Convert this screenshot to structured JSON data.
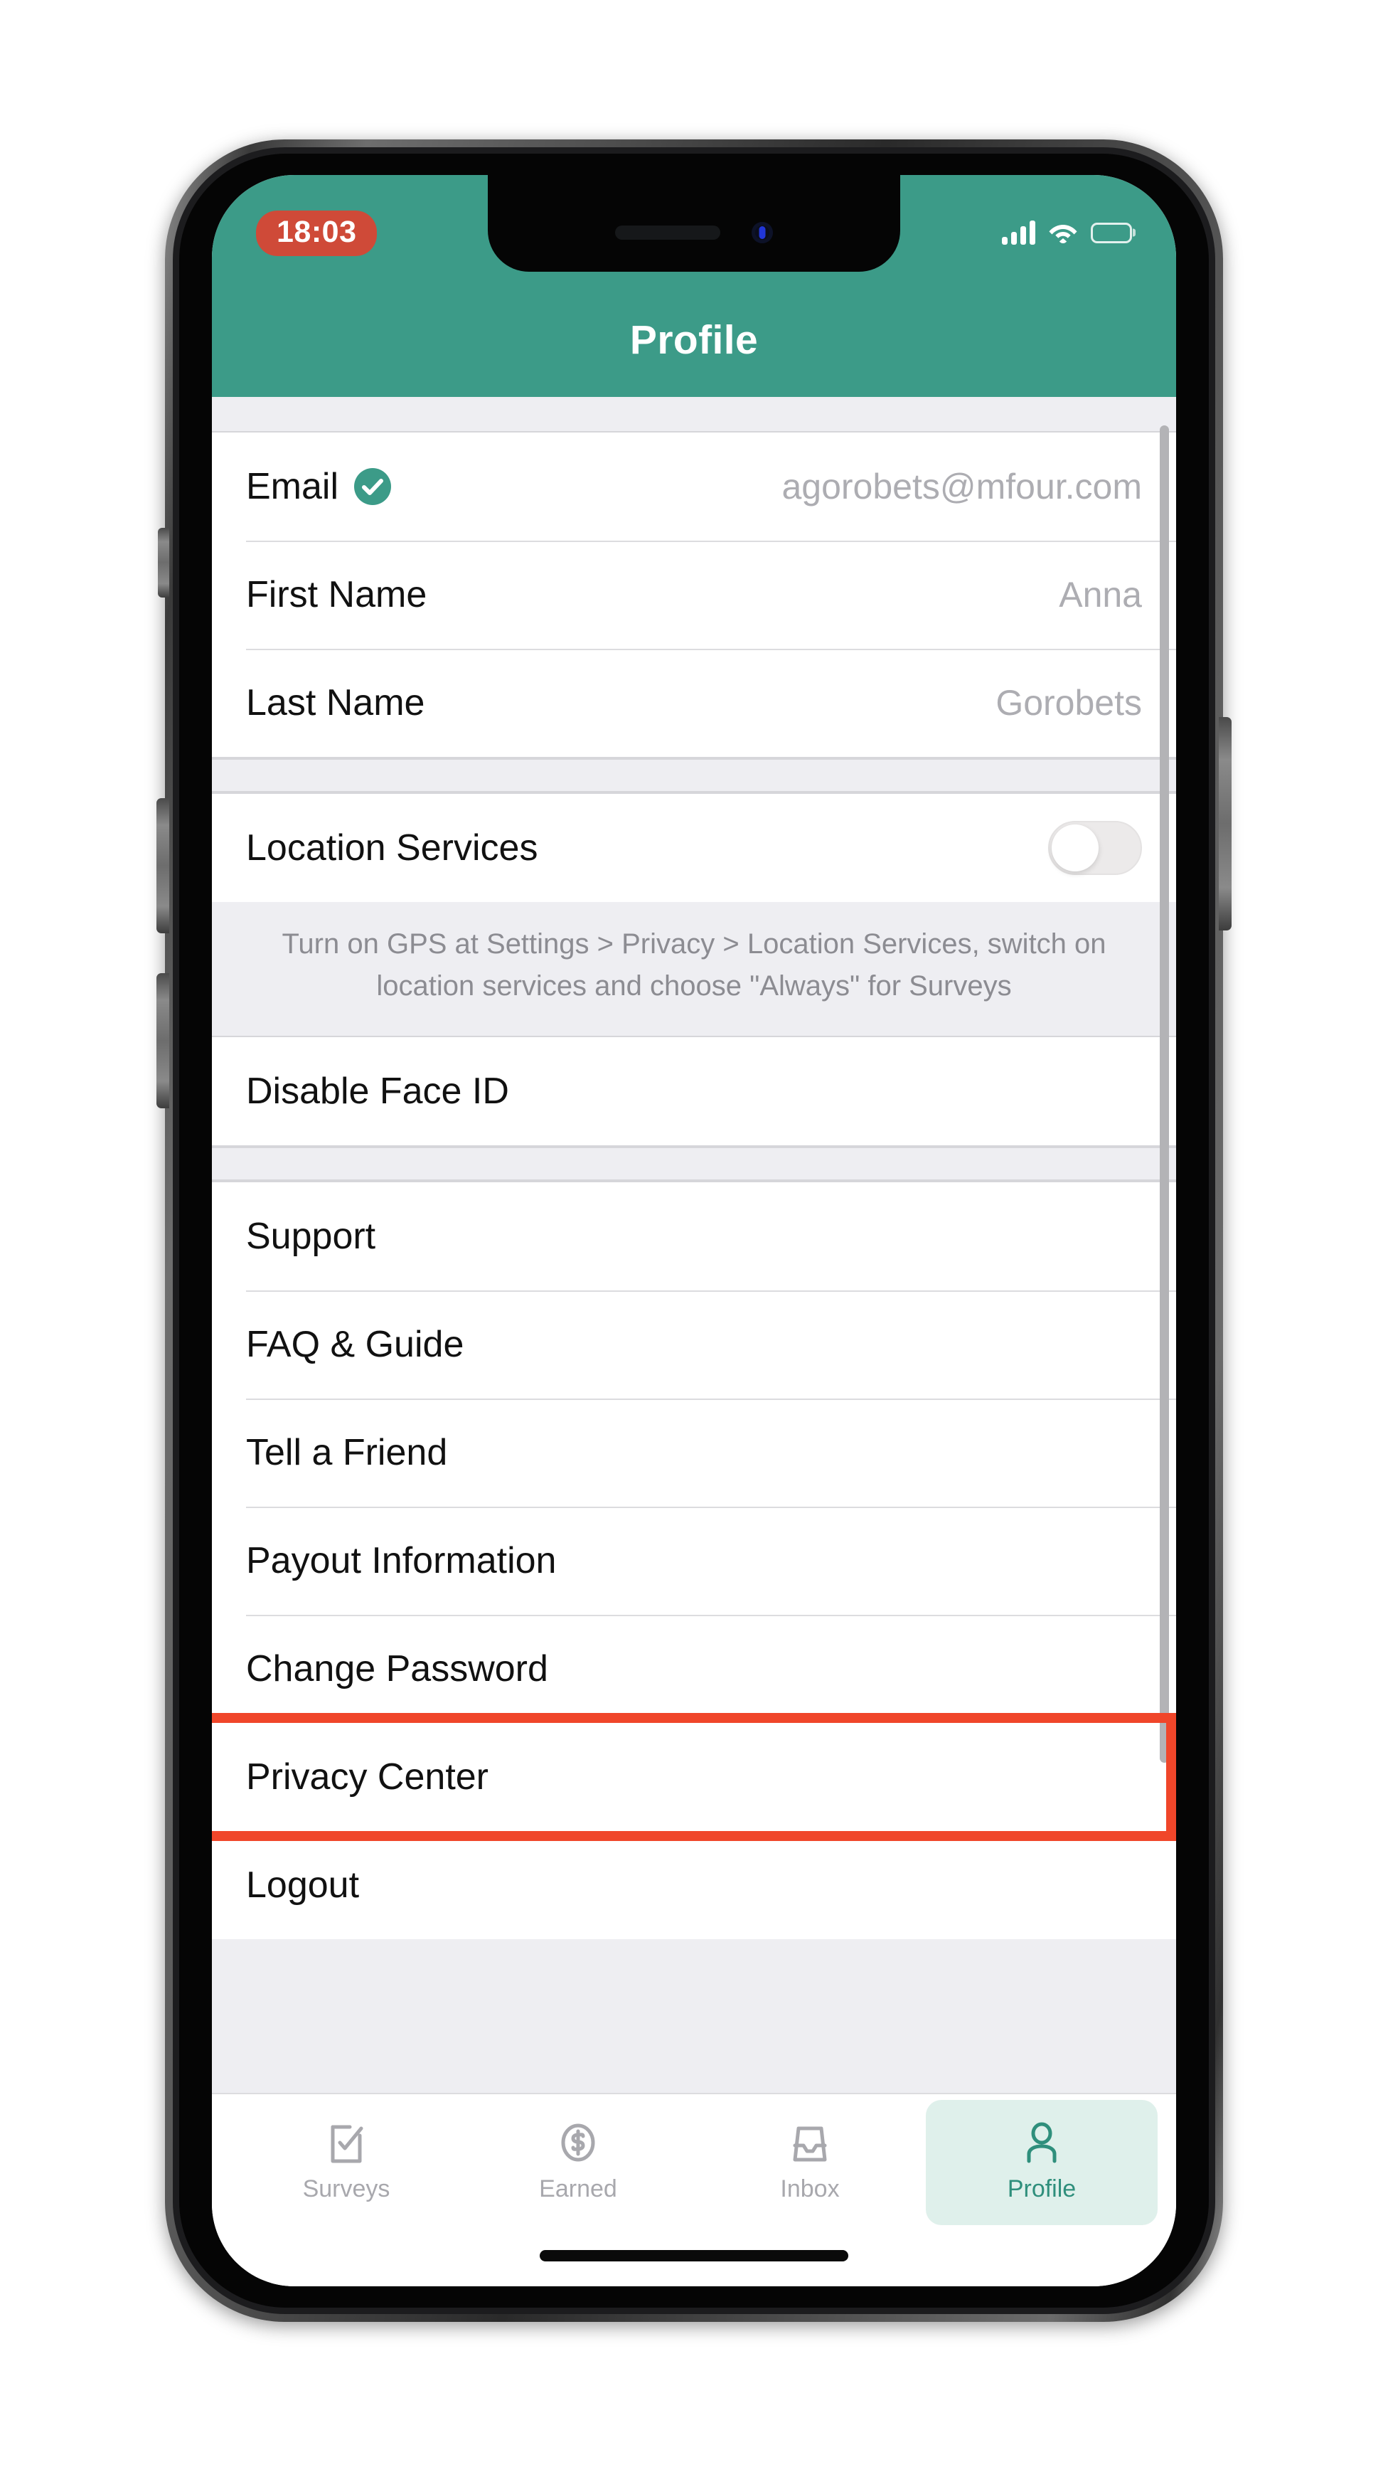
{
  "status_bar": {
    "time": "18:03",
    "time_pill_color": "#cf4a38",
    "cellular_icon": "signal-bars-icon",
    "wifi_icon": "wifi-icon",
    "battery_icon": "battery-icon"
  },
  "header": {
    "title": "Profile",
    "background_color": "#3c9b88",
    "title_color": "#ffffff"
  },
  "profile_section": {
    "rows": [
      {
        "label": "Email",
        "value": "agorobets@mfour.com",
        "verified": true,
        "badge_icon": "check-circle-icon"
      },
      {
        "label": "First Name",
        "value": "Anna",
        "verified": false
      },
      {
        "label": "Last Name",
        "value": "Gorobets",
        "verified": false
      }
    ]
  },
  "location_section": {
    "label": "Location Services",
    "toggle_state": "off",
    "toggle_icon": "toggle-switch-icon",
    "hint": "Turn on GPS at Settings > Privacy > Location Services, switch on location services and choose \"Always\" for Surveys"
  },
  "faceid_section": {
    "label": "Disable Face ID"
  },
  "menu_section": {
    "items": [
      {
        "label": "Support",
        "highlighted": false
      },
      {
        "label": "FAQ & Guide",
        "highlighted": false
      },
      {
        "label": "Tell a Friend",
        "highlighted": false
      },
      {
        "label": "Payout Information",
        "highlighted": false
      },
      {
        "label": "Change Password",
        "highlighted": false
      },
      {
        "label": "Privacy Center",
        "highlighted": true
      },
      {
        "label": "Logout",
        "highlighted": false
      }
    ]
  },
  "annotation": {
    "target_label": "Privacy Center",
    "box_color": "#f0462a"
  },
  "tab_bar": {
    "tabs": [
      {
        "label": "Surveys",
        "icon": "survey-checklist-icon",
        "active": false
      },
      {
        "label": "Earned",
        "icon": "dollar-coin-icon",
        "active": false
      },
      {
        "label": "Inbox",
        "icon": "inbox-tray-icon",
        "active": false
      },
      {
        "label": "Profile",
        "icon": "person-icon",
        "active": true
      }
    ],
    "active_color": "#2f8f7c",
    "active_pill_color": "#dff0eb",
    "inactive_color": "#a8a8ad"
  },
  "scrollbar": {
    "visible": true
  }
}
